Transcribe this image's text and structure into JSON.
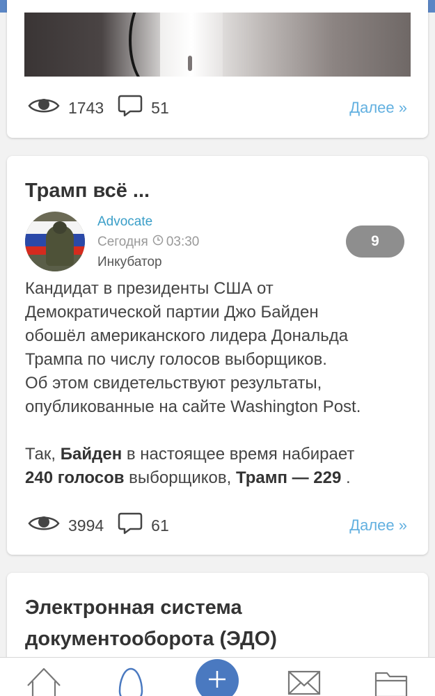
{
  "posts": [
    {
      "views": "1743",
      "comments": "51",
      "more_label": "Далее »"
    },
    {
      "title": "Трамп всё ...",
      "author": "Advocate",
      "date": "Сегодня",
      "time": "03:30",
      "category": "Инкубатор",
      "rating": "9",
      "body": {
        "p1_lines": [
          "Кандидат в президенты США от",
          "Демократической партии Джо Байден",
          "обошёл американского лидера Дональда",
          "Трампа по числу голосов выборщиков.",
          "Об этом свидетельствуют результаты,",
          "опубликованные на сайте Washington Post."
        ],
        "p2_start": "Так, ",
        "p2_bold1": "Байден",
        "p2_mid": " в настоящее время набирает",
        "p2_bold2": "240 голосов",
        "p2_mid2": " выборщиков, ",
        "p2_bold3": "Трамп — 229",
        "p2_end": " ."
      },
      "views": "3994",
      "comments": "61",
      "more_label": "Далее »"
    },
    {
      "title_line1": "Электронная система",
      "title_line2": "документооборота (ЭДО)"
    }
  ],
  "nav": {
    "items": [
      "home-icon",
      "egg-icon",
      "plus-icon",
      "mail-icon",
      "folder-icon"
    ],
    "accent": "#4a79c0"
  },
  "colors": {
    "topbar": "#5b86c5",
    "link": "#62b0e0",
    "author": "#3a9ec8",
    "badge": "#8e8e8e"
  }
}
